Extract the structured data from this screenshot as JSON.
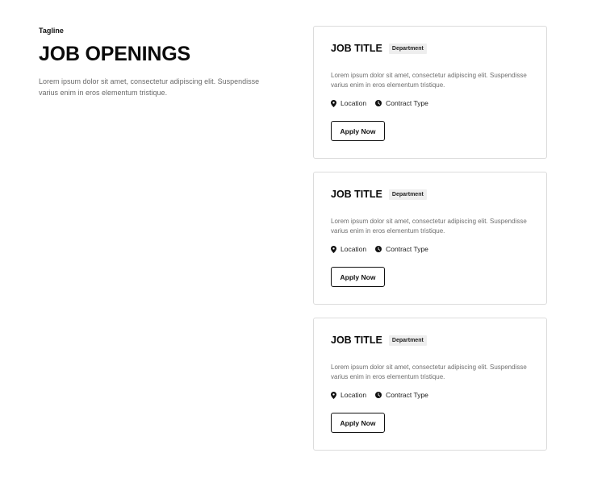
{
  "header": {
    "tagline": "Tagline",
    "title": "JOB OPENINGS",
    "description": "Lorem ipsum dolor sit amet, consectetur adipiscing elit. Suspendisse varius enim in eros elementum tristique."
  },
  "jobs": [
    {
      "title": "JOB TITLE",
      "department": "Department",
      "description": "Lorem ipsum dolor sit amet, consectetur adipiscing elit. Suspendisse varius enim in eros elementum tristique.",
      "location": "Location",
      "contract_type": "Contract Type",
      "apply_label": "Apply Now"
    },
    {
      "title": "JOB TITLE",
      "department": "Department",
      "description": "Lorem ipsum dolor sit amet, consectetur adipiscing elit. Suspendisse varius enim in eros elementum tristique.",
      "location": "Location",
      "contract_type": "Contract Type",
      "apply_label": "Apply Now"
    },
    {
      "title": "JOB TITLE",
      "department": "Department",
      "description": "Lorem ipsum dolor sit amet, consectetur adipiscing elit. Suspendisse varius enim in eros elementum tristique.",
      "location": "Location",
      "contract_type": "Contract Type",
      "apply_label": "Apply Now"
    }
  ],
  "icons": {
    "location": "map-pin-icon",
    "contract": "clock-icon"
  },
  "colors": {
    "text": "#111111",
    "muted": "#6f6f6f",
    "border": "#dcdcdc",
    "badge_bg": "#eeeeee"
  }
}
